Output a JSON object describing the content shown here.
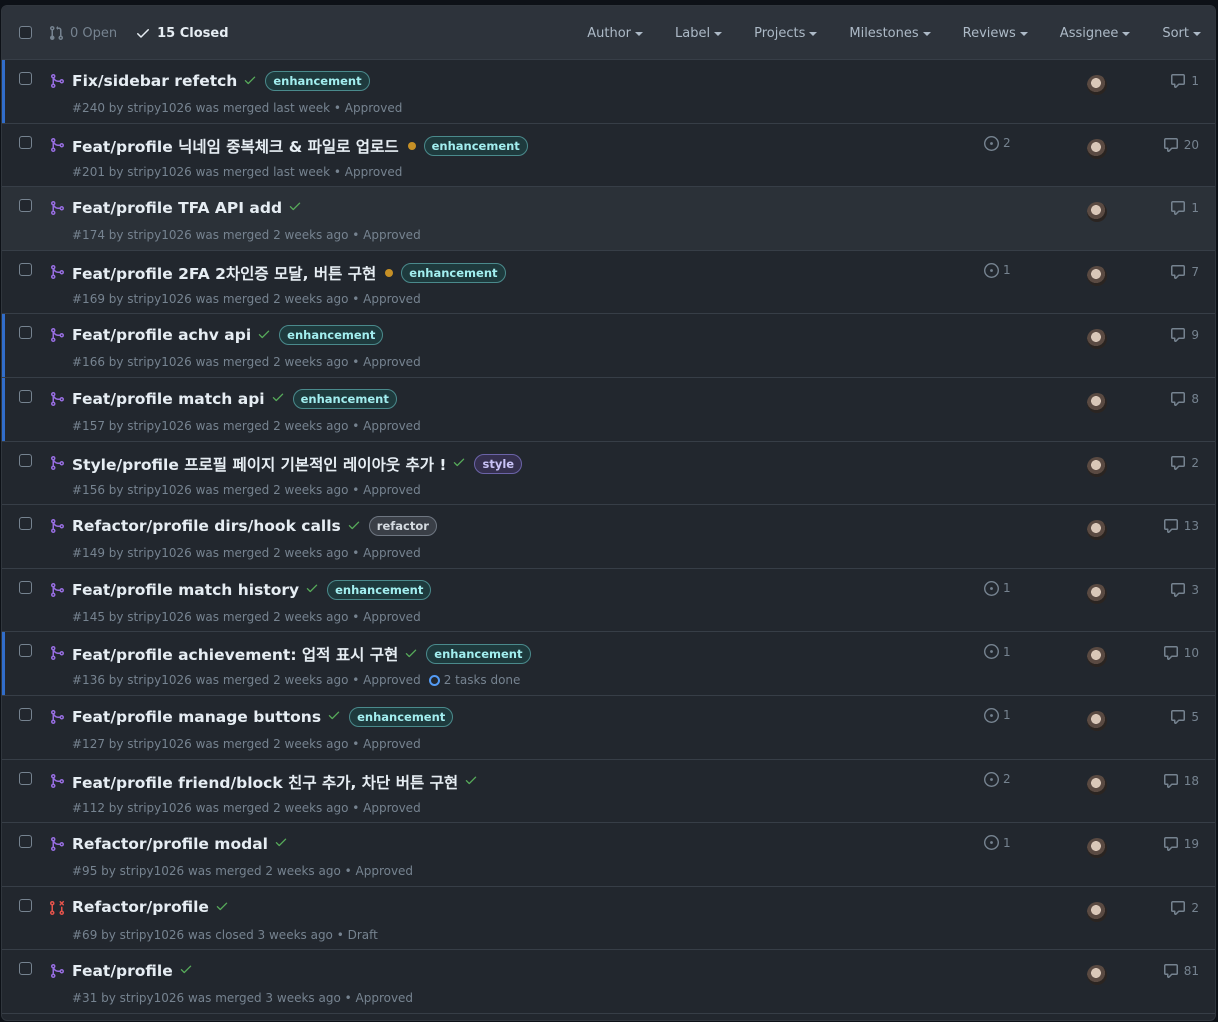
{
  "header": {
    "open_label": "0 Open",
    "closed_label": "15 Closed",
    "filters": [
      "Author",
      "Label",
      "Projects",
      "Milestones",
      "Reviews",
      "Assignee",
      "Sort"
    ]
  },
  "colors": {
    "merged": "#986ee2",
    "closed": "#e5534b",
    "check": "#57ab5a",
    "pending": "#c69026"
  },
  "prs": [
    {
      "title": "Fix/sidebar refetch",
      "status": "check",
      "label": "enhancement",
      "meta": "#240 by stripy1026 was merged last week • Approved",
      "linked": "",
      "comments": "1",
      "unread": true,
      "type": "merged"
    },
    {
      "title": "Feat/profile 닉네임 중복체크 & 파일로 업로드",
      "status": "dot",
      "label": "enhancement",
      "meta": "#201 by stripy1026 was merged last week • Approved",
      "linked": "2",
      "comments": "20",
      "unread": false,
      "type": "merged"
    },
    {
      "title": "Feat/profile TFA API add",
      "status": "check",
      "label": "",
      "meta": "#174 by stripy1026 was merged 2 weeks ago • Approved",
      "linked": "",
      "comments": "1",
      "unread": false,
      "type": "merged",
      "highlight": true
    },
    {
      "title": "Feat/profile 2FA 2차인증 모달, 버튼 구현",
      "status": "dot",
      "label": "enhancement",
      "meta": "#169 by stripy1026 was merged 2 weeks ago • Approved",
      "linked": "1",
      "comments": "7",
      "unread": false,
      "type": "merged"
    },
    {
      "title": "Feat/profile achv api",
      "status": "check",
      "label": "enhancement",
      "meta": "#166 by stripy1026 was merged 2 weeks ago • Approved",
      "linked": "",
      "comments": "9",
      "unread": true,
      "type": "merged"
    },
    {
      "title": "Feat/profile match api",
      "status": "check",
      "label": "enhancement",
      "meta": "#157 by stripy1026 was merged 2 weeks ago • Approved",
      "linked": "",
      "comments": "8",
      "unread": true,
      "type": "merged"
    },
    {
      "title": "Style/profile 프로필 페이지 기본적인 레이아웃 추가 !",
      "status": "check",
      "label": "style",
      "meta": "#156 by stripy1026 was merged 2 weeks ago • Approved",
      "linked": "",
      "comments": "2",
      "unread": false,
      "type": "merged"
    },
    {
      "title": "Refactor/profile dirs/hook calls",
      "status": "check",
      "label": "refactor",
      "meta": "#149 by stripy1026 was merged 2 weeks ago • Approved",
      "linked": "",
      "comments": "13",
      "unread": false,
      "type": "merged"
    },
    {
      "title": "Feat/profile match history",
      "status": "check",
      "label": "enhancement",
      "meta": "#145 by stripy1026 was merged 2 weeks ago • Approved",
      "linked": "1",
      "comments": "3",
      "unread": false,
      "type": "merged"
    },
    {
      "title": "Feat/profile achievement: 업적 표시 구현",
      "status": "check",
      "label": "enhancement",
      "meta": "#136 by stripy1026 was merged 2 weeks ago • Approved",
      "tasks": "2 tasks done",
      "linked": "1",
      "comments": "10",
      "unread": true,
      "type": "merged"
    },
    {
      "title": "Feat/profile manage buttons",
      "status": "check",
      "label": "enhancement",
      "meta": "#127 by stripy1026 was merged 2 weeks ago • Approved",
      "linked": "1",
      "comments": "5",
      "unread": false,
      "type": "merged"
    },
    {
      "title": "Feat/profile friend/block 친구 추가, 차단 버튼 구현",
      "status": "check",
      "label": "",
      "meta": "#112 by stripy1026 was merged 2 weeks ago • Approved",
      "linked": "2",
      "comments": "18",
      "unread": false,
      "type": "merged"
    },
    {
      "title": "Refactor/profile modal",
      "status": "check",
      "label": "",
      "meta": "#95 by stripy1026 was merged 2 weeks ago • Approved",
      "linked": "1",
      "comments": "19",
      "unread": false,
      "type": "merged"
    },
    {
      "title": "Refactor/profile",
      "status": "check",
      "label": "",
      "meta": "#69 by stripy1026 was closed 3 weeks ago • Draft",
      "linked": "",
      "comments": "2",
      "unread": false,
      "type": "closed"
    },
    {
      "title": "Feat/profile",
      "status": "check",
      "label": "",
      "meta": "#31 by stripy1026 was merged 3 weeks ago • Approved",
      "linked": "",
      "comments": "81",
      "unread": false,
      "type": "merged"
    }
  ]
}
